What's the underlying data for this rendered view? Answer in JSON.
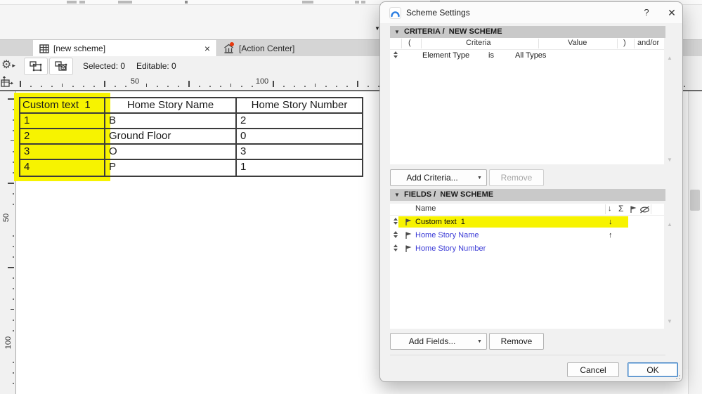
{
  "app": {
    "tabs": [
      {
        "label": "[new scheme]"
      },
      {
        "label": "[Action Center]"
      }
    ],
    "tab_close_glyph": "×",
    "toolbar": {
      "selected": "Selected: 0",
      "editable": "Editable: 0"
    },
    "rulers": {
      "horizontal_labels": [
        "50",
        "100"
      ],
      "vertical_labels": [
        "50",
        "100"
      ]
    }
  },
  "glyphs": {
    "gear": "⚙",
    "flyout_arrow": "▸",
    "dropdown": "▼",
    "scroll_up": "▲",
    "scroll_down": "▼"
  },
  "schedule": {
    "highlight_color": "#f7f300",
    "columns": [
      "Custom text  1",
      "Home Story Name",
      "Home Story Number"
    ],
    "rows": [
      [
        "1",
        "B",
        "2"
      ],
      [
        "2",
        "Ground Floor",
        "0"
      ],
      [
        "3",
        "O",
        "3"
      ],
      [
        "4",
        "P",
        "1"
      ]
    ]
  },
  "dialog": {
    "title": "Scheme Settings",
    "help": "?",
    "close": "✕",
    "criteria": {
      "header": "CRITERIA /  NEW SCHEME",
      "columns": [
        "(",
        "Criteria",
        "Value",
        ")",
        "and/or"
      ],
      "row": {
        "criteria": "Element Type",
        "operator": "is",
        "value": "All Types"
      },
      "add_button": "Add Criteria...",
      "remove_button": "Remove"
    },
    "fields": {
      "header": "FIELDS /  NEW SCHEME",
      "name_column": "Name",
      "sort_column_glyph": "↓",
      "sum_column_glyph": "Σ",
      "rows": [
        {
          "name": "Custom text  1",
          "sort": "↓"
        },
        {
          "name": "Home Story Name",
          "sort": "↑"
        },
        {
          "name": "Home Story Number",
          "sort": ""
        }
      ],
      "add_button": "Add Fields...",
      "remove_button": "Remove"
    },
    "cancel": "Cancel",
    "ok": "OK"
  }
}
